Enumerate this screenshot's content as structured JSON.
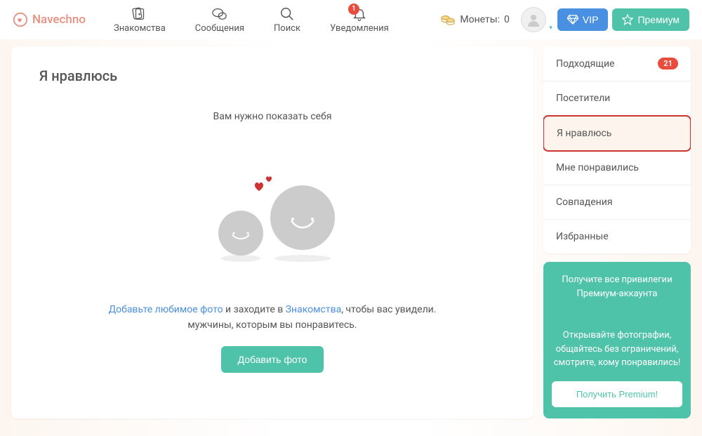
{
  "logo": "Navechno",
  "nav": {
    "meet": "Знакомства",
    "messages": "Сообщения",
    "search": "Поиск",
    "notifications": "Уведомления",
    "notif_badge": "1"
  },
  "coins": {
    "label": "Монеты:",
    "value": "0"
  },
  "buttons": {
    "vip": "VIP",
    "premium": "Премиум"
  },
  "main": {
    "title": "Я нравлюсь",
    "subtitle": "Вам нужно показать себя",
    "link1": "Добавьте любимое фото",
    "mid1": " и заходите в ",
    "link2": "Знакомства",
    "mid2": ", чтобы вас увидели.",
    "line2": "мужчины, которым вы понравитесь.",
    "add_photo": "Добавить фото"
  },
  "sidebar": {
    "items": [
      {
        "label": "Подходящие",
        "badge": "21"
      },
      {
        "label": "Посетители"
      },
      {
        "label": "Я нравлюсь",
        "active": true
      },
      {
        "label": "Мне понравились"
      },
      {
        "label": "Совпадения"
      },
      {
        "label": "Избранные"
      }
    ]
  },
  "promo": {
    "title": "Получите все привилегии Премиум-аккаунта",
    "desc": "Открывайте фотографии, общайтесь без ограничений, смотрите, кому понравились!",
    "cta": "Получить Premium!"
  }
}
